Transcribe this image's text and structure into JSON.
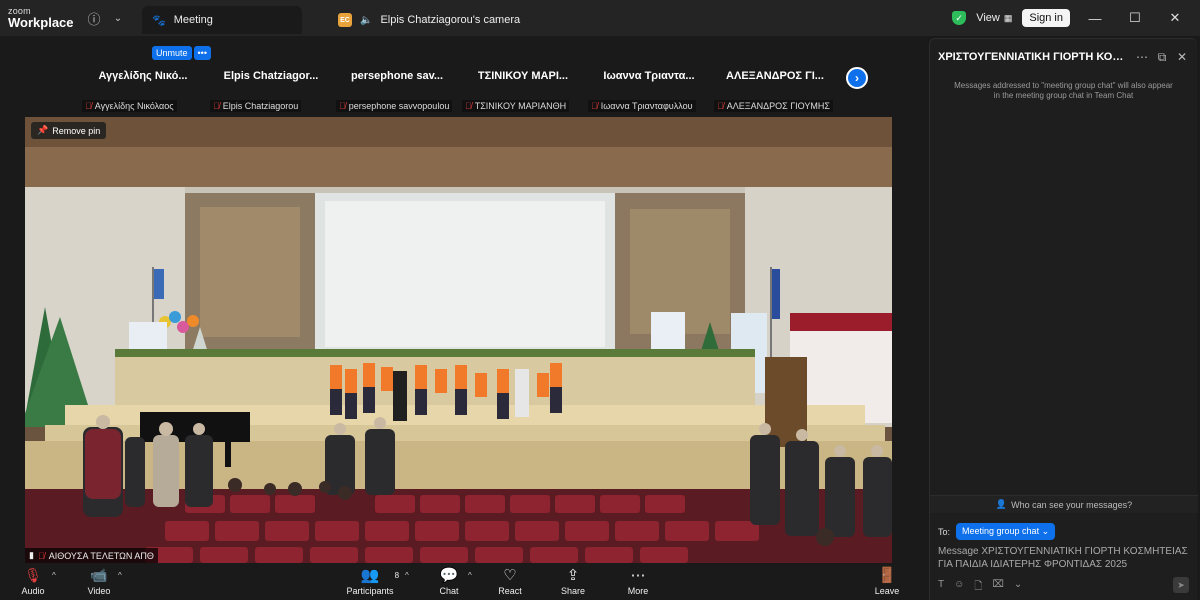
{
  "app": {
    "brand_line1": "zoom",
    "brand_line2": "Workplace"
  },
  "tabs": [
    {
      "label": "Meeting",
      "icon": "paw-icon"
    },
    {
      "label": "Elpis Chatziagorou's camera",
      "badge": "EC"
    }
  ],
  "titlebar": {
    "view_label": "View",
    "signin_label": "Sign in"
  },
  "self_controls": {
    "unmute_label": "Unmute",
    "more_label": "•••"
  },
  "participants": [
    {
      "name": "Αγγελίδης Νικό...",
      "label": "Αγγελίδης Νικόλαος"
    },
    {
      "name": "Elpis  Chatziagor...",
      "label": "Elpis Chatziagorou"
    },
    {
      "name": "persephone  sav...",
      "label": "persephone savvopoulou"
    },
    {
      "name": "ΤΣΙΝΙΚΟΥ  ΜΑΡΙ...",
      "label": "ΤΣΙΝΙΚΟΥ ΜΑΡΙΑΝΘΗ"
    },
    {
      "name": "Ιωαννα  Τριαντα...",
      "label": "Ιωαννα Τριανταφυλλου"
    },
    {
      "name": "ΑΛΕΞΑΝΔΡΟΣ  ΓΙ...",
      "label": "ΑΛΕΞΑΝΔΡΟΣ ΓΙΟΥΜΗΣ"
    }
  ],
  "video": {
    "remove_pin_label": "Remove pin",
    "source_label": "ΑΙΘΟΥΣΑ ΤΕΛΕΤΩΝ ΑΠΘ",
    "podium_text": "ΕΚΗΛ"
  },
  "chat": {
    "title": "ΧΡΙΣΤΟΥΓΕΝΝΙΑΤΙΚΗ ΓΙΟΡΤΗ ΚΟΣΜΗΤΕΙΑ...",
    "note": "Messages addressed to \"meeting group chat\" will also appear in the meeting group chat in Team Chat",
    "who_label": "Who can see your messages?",
    "to_label": "To:",
    "to_value": "Meeting group chat",
    "input_placeholder": "Message ΧΡΙΣΤΟΥΓΕΝΝΙΑΤΙΚΗ ΓΙΟΡΤΗ ΚΟΣΜΗΤΕΙΑΣ ΓΙΑ ΠΑΙΔΙΑ ΙΔΙΑΤΕΡΗΣ ΦΡΟΝΤΙΔΑΣ 2025"
  },
  "toolbar": {
    "audio": "Audio",
    "video": "Video",
    "participants": "Participants",
    "participants_count": "8",
    "chat": "Chat",
    "react": "React",
    "share": "Share",
    "more": "More",
    "leave": "Leave"
  },
  "colors": {
    "accent": "#0e71eb",
    "danger": "#e53e3e",
    "secure": "#2dbd5a",
    "background": "#1a1a1a"
  }
}
